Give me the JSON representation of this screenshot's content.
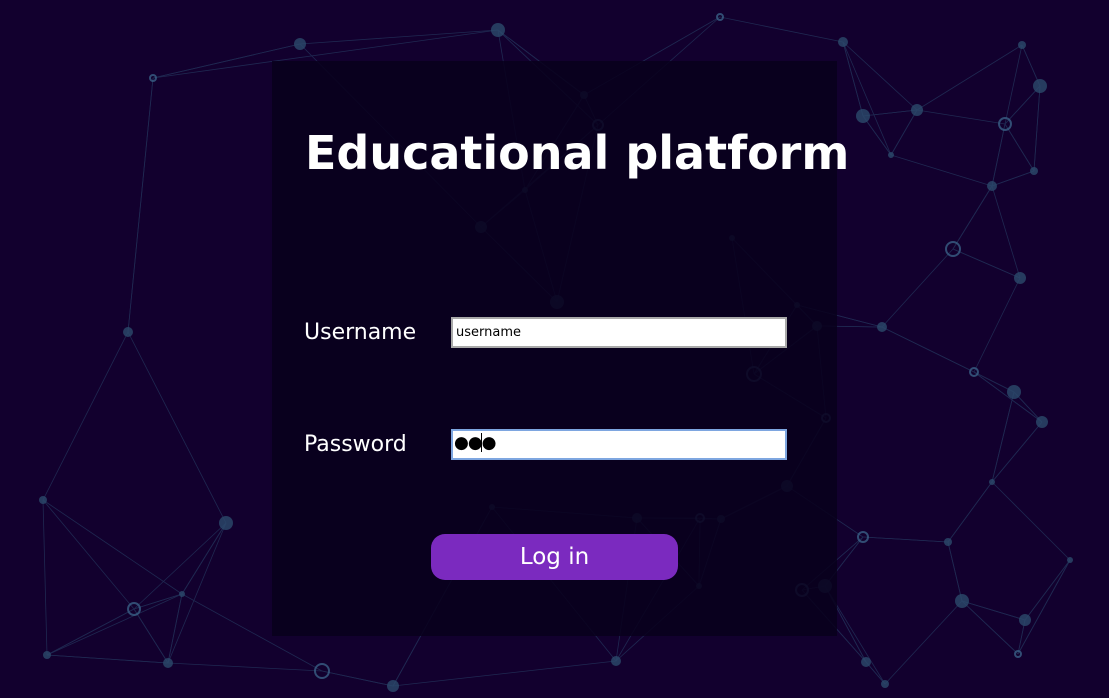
{
  "app": {
    "title": "Educational platform"
  },
  "form": {
    "username_label": "Username",
    "username_value": "username",
    "password_label": "Password",
    "password_masked": "●●●",
    "login_label": "Log in"
  },
  "colors": {
    "background": "#12002e",
    "panel": "#08001c",
    "button": "#7b2abf",
    "network_lines": "#2a4a6e",
    "input_focus_border": "#7ea6e0"
  }
}
